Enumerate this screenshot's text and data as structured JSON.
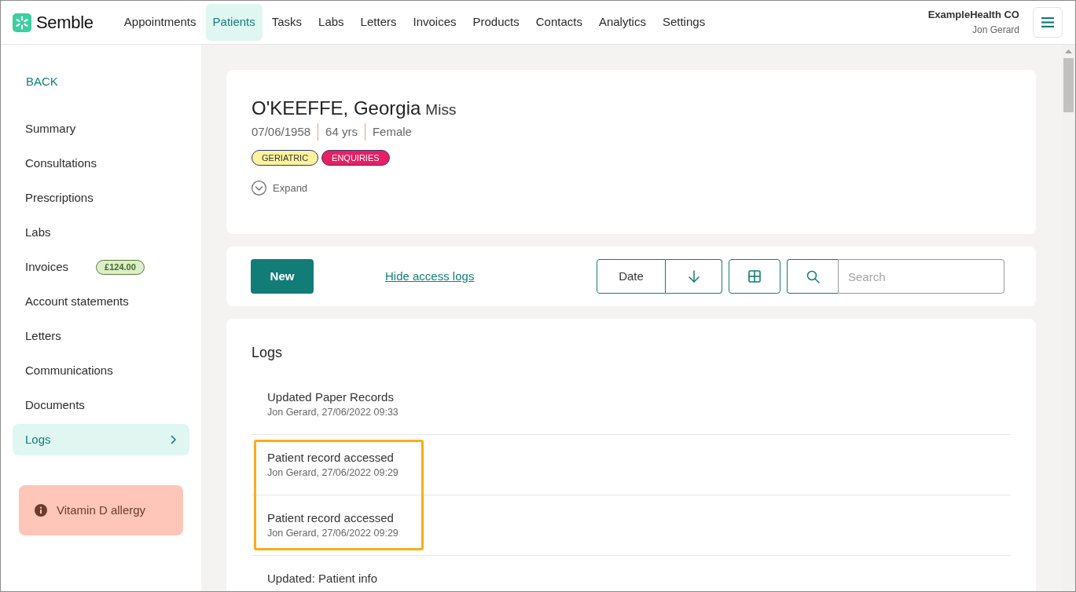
{
  "app": {
    "logo": "Semble"
  },
  "nav": {
    "items": [
      {
        "label": "Appointments",
        "selected": false
      },
      {
        "label": "Patients",
        "selected": true
      },
      {
        "label": "Tasks",
        "selected": false
      },
      {
        "label": "Labs",
        "selected": false
      },
      {
        "label": "Letters",
        "selected": false
      },
      {
        "label": "Invoices",
        "selected": false
      },
      {
        "label": "Products",
        "selected": false
      },
      {
        "label": "Contacts",
        "selected": false
      },
      {
        "label": "Analytics",
        "selected": false
      },
      {
        "label": "Settings",
        "selected": false
      }
    ]
  },
  "account": {
    "organisation": "ExampleHealth CO",
    "user": "Jon Gerard"
  },
  "sidebar": {
    "back": "BACK",
    "items": [
      {
        "label": "Summary",
        "selected": false
      },
      {
        "label": "Consultations",
        "selected": false
      },
      {
        "label": "Prescriptions",
        "selected": false
      },
      {
        "label": "Labs",
        "selected": false
      },
      {
        "label": "Invoices",
        "selected": false,
        "badge": "£124.00"
      },
      {
        "label": "Account statements",
        "selected": false
      },
      {
        "label": "Letters",
        "selected": false
      },
      {
        "label": "Communications",
        "selected": false
      },
      {
        "label": "Documents",
        "selected": false
      },
      {
        "label": "Logs",
        "selected": true
      }
    ],
    "alert": "Vitamin D allergy"
  },
  "patient": {
    "name": "O'KEEFFE, Georgia",
    "title": "Miss",
    "details": [
      "07/06/1958",
      "64 yrs",
      "Female"
    ],
    "tags": [
      {
        "label": "GERIATRIC",
        "color": "#fdf39c"
      },
      {
        "label": "ENQUIRIES",
        "color": "#e91e63"
      }
    ],
    "expand": {
      "label": "Expand",
      "expanded": false
    }
  },
  "toolbar": {
    "new_button": "New",
    "toggle_link": "Hide access logs",
    "sort": {
      "field": "Date"
    },
    "search": {
      "placeholder": "Search"
    }
  },
  "logs": {
    "title": "Logs",
    "entries": [
      {
        "title": "Updated Paper Records",
        "meta": "Jon Gerard, 27/06/2022 09:33",
        "highlighted": false
      },
      {
        "title": "Patient record accessed",
        "meta": "Jon Gerard, 27/06/2022 09:29",
        "highlighted": true
      },
      {
        "title": "Patient record accessed",
        "meta": "Jon Gerard, 27/06/2022 09:29",
        "highlighted": true
      },
      {
        "title": "Updated: Patient info",
        "highlighted": false
      }
    ]
  }
}
